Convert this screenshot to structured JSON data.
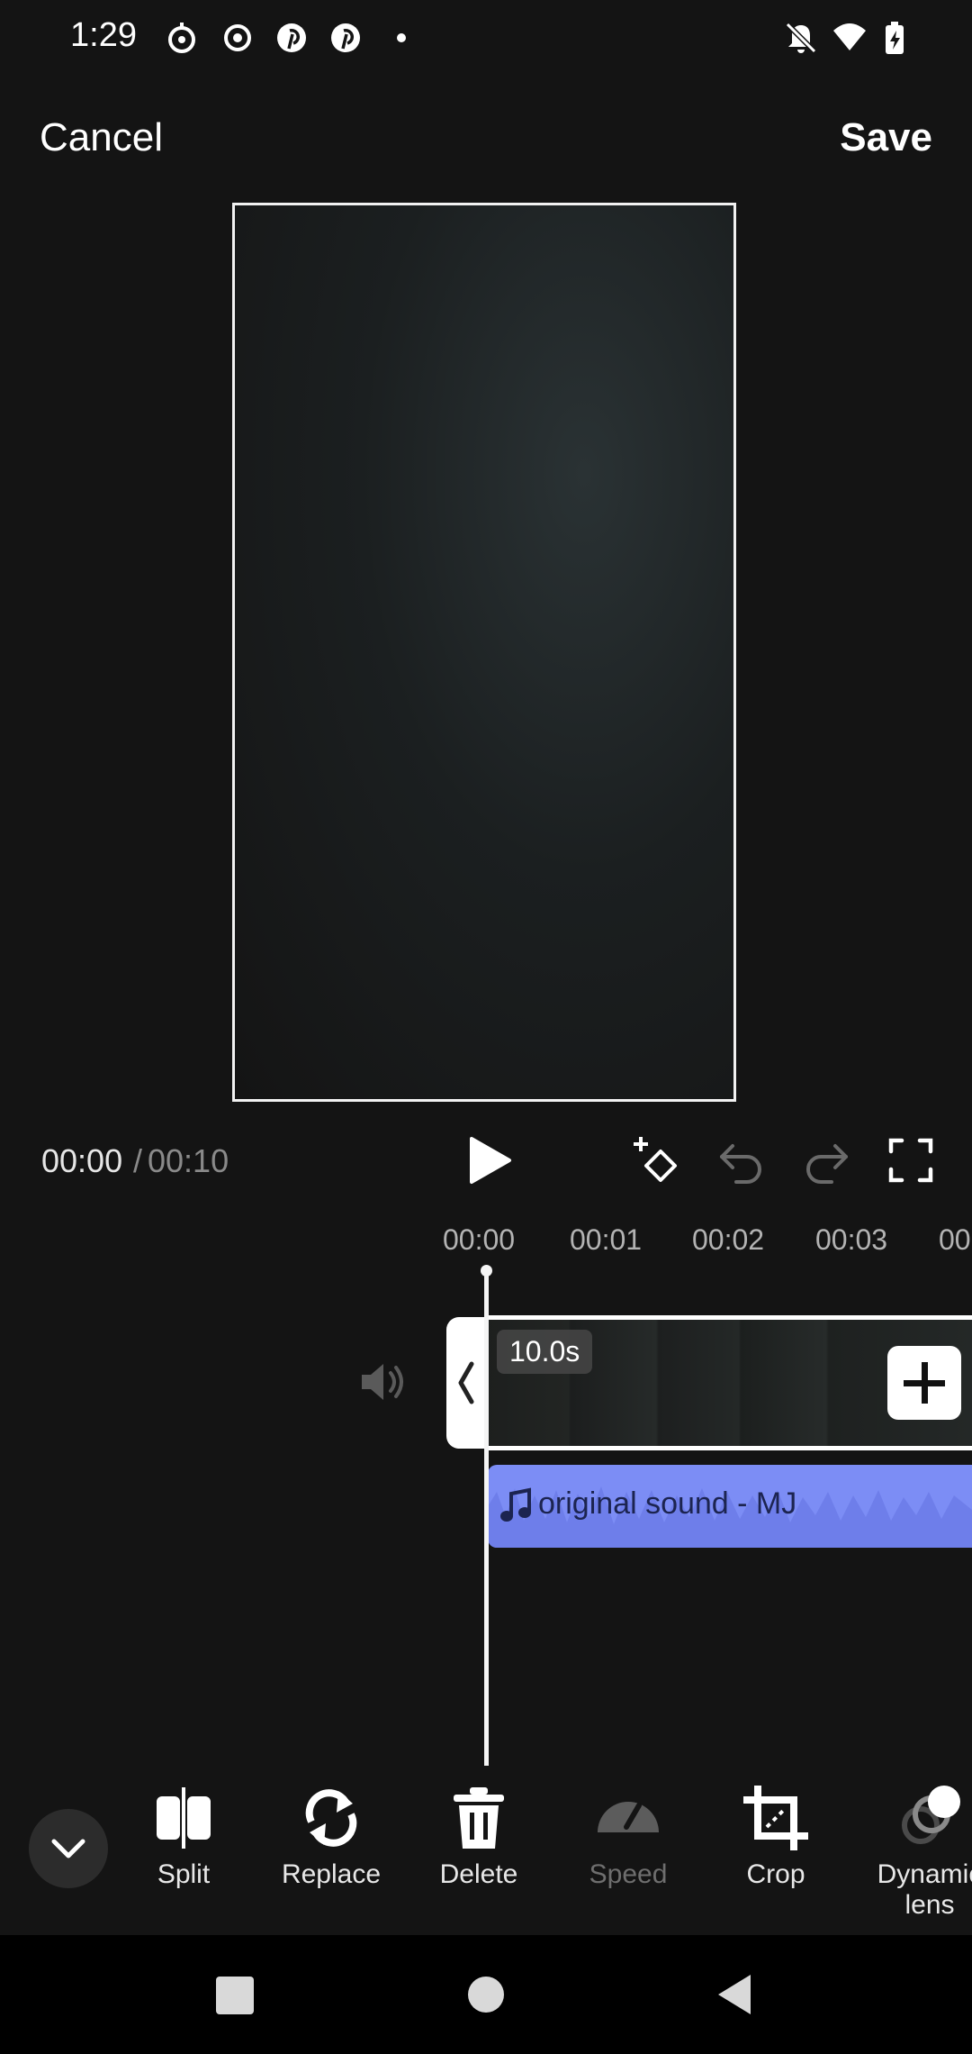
{
  "status_bar": {
    "time": "1:29"
  },
  "header": {
    "cancel_label": "Cancel",
    "save_label": "Save"
  },
  "playback": {
    "current_time": "00:00",
    "separator": "/",
    "total_time": "00:10"
  },
  "ruler": {
    "ticks": [
      "00:00",
      "00:01",
      "00:02",
      "00:03",
      "00"
    ]
  },
  "clip": {
    "duration": "10.0s"
  },
  "audio": {
    "label": "original sound - MJ",
    "color": "#7c8df5"
  },
  "toolbar": {
    "items": [
      {
        "label": "Split",
        "icon": "split-icon",
        "enabled": true
      },
      {
        "label": "Replace",
        "icon": "replace-icon",
        "enabled": true
      },
      {
        "label": "Delete",
        "icon": "delete-icon",
        "enabled": true
      },
      {
        "label": "Speed",
        "icon": "speed-icon",
        "enabled": false
      },
      {
        "label": "Crop",
        "icon": "crop-icon",
        "enabled": true
      },
      {
        "label": "Dynamic\nlens",
        "icon": "dynamic-lens-icon",
        "enabled": true
      }
    ]
  }
}
